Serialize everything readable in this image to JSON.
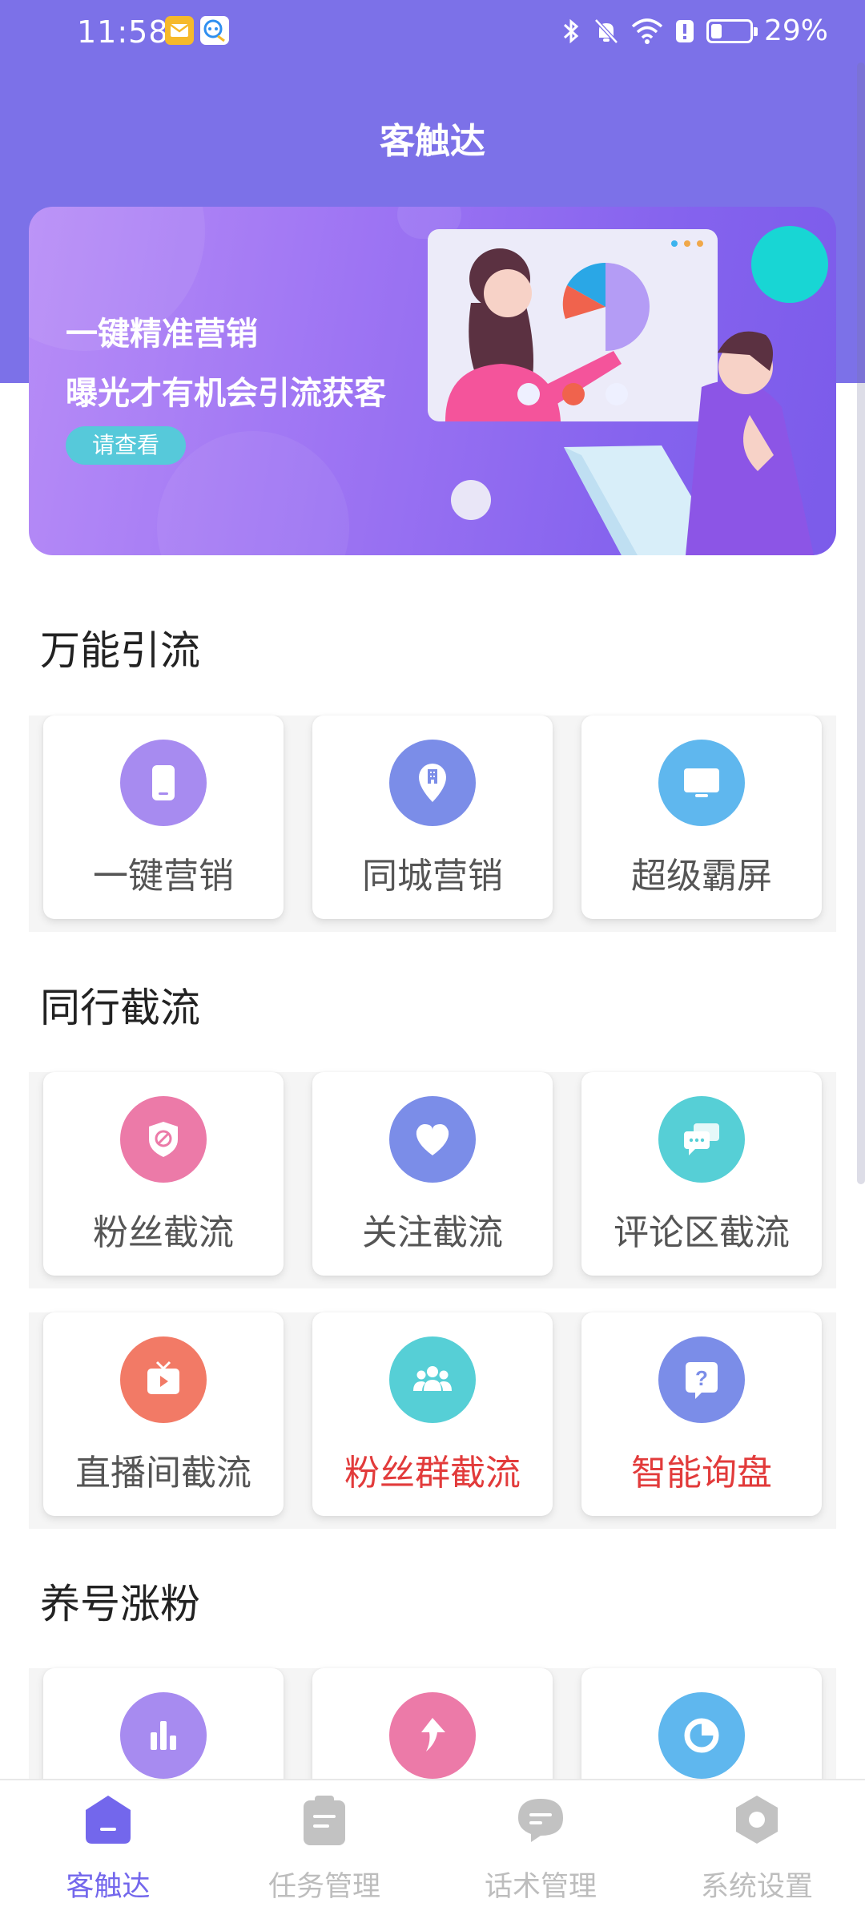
{
  "status_bar": {
    "time": "11:58",
    "battery_percent": "29%",
    "battery_level": 0.29,
    "icons": [
      "mail-app-icon",
      "chat-app-icon",
      "bluetooth-icon",
      "mute-icon",
      "wifi-icon",
      "alert-icon",
      "battery-icon"
    ]
  },
  "header": {
    "title": "客触达"
  },
  "banner": {
    "line1": "一键精准营销",
    "line2": "曝光才有机会引流获客",
    "button_label": "请查看"
  },
  "sections": [
    {
      "title": "万能引流",
      "items": [
        {
          "label": "一键营销",
          "icon": "tablet-icon",
          "color": "#a78bf0",
          "hot": false
        },
        {
          "label": "同城营销",
          "icon": "location-building-icon",
          "color": "#7b8de8",
          "hot": false
        },
        {
          "label": "超级霸屏",
          "icon": "monitor-icon",
          "color": "#5fb7ee",
          "hot": false
        }
      ]
    },
    {
      "title": "同行截流",
      "items": [
        {
          "label": "粉丝截流",
          "icon": "shield-block-icon",
          "color": "#ec7aa8",
          "hot": false
        },
        {
          "label": "关注截流",
          "icon": "heart-icon",
          "color": "#7b8de8",
          "hot": false
        },
        {
          "label": "评论区截流",
          "icon": "comment-icon",
          "color": "#56cfd6",
          "hot": false
        },
        {
          "label": "直播间截流",
          "icon": "tv-play-icon",
          "color": "#f27a66",
          "hot": false
        },
        {
          "label": "粉丝群截流",
          "icon": "group-icon",
          "color": "#56cfd6",
          "hot": true
        },
        {
          "label": "智能询盘",
          "icon": "question-icon",
          "color": "#7b8de8",
          "hot": true
        }
      ]
    },
    {
      "title": "养号涨粉",
      "items": [
        {
          "label": "",
          "icon": "bar-chart-icon",
          "color": "#a78bf0",
          "hot": false
        },
        {
          "label": "",
          "icon": "arrow-up-icon",
          "color": "#ec7aa8",
          "hot": false
        },
        {
          "label": "",
          "icon": "pie-chart-icon",
          "color": "#5fb7ee",
          "hot": false
        }
      ]
    }
  ],
  "tabbar": {
    "active": 0,
    "tabs": [
      {
        "label": "客触达",
        "icon": "home-icon"
      },
      {
        "label": "任务管理",
        "icon": "clipboard-icon"
      },
      {
        "label": "话术管理",
        "icon": "chat-bubble-icon"
      },
      {
        "label": "系统设置",
        "icon": "settings-icon"
      }
    ]
  },
  "colors": {
    "primary": "#7c71e8",
    "accent_text": "#7367ec",
    "hot_text": "#e23b3b"
  }
}
